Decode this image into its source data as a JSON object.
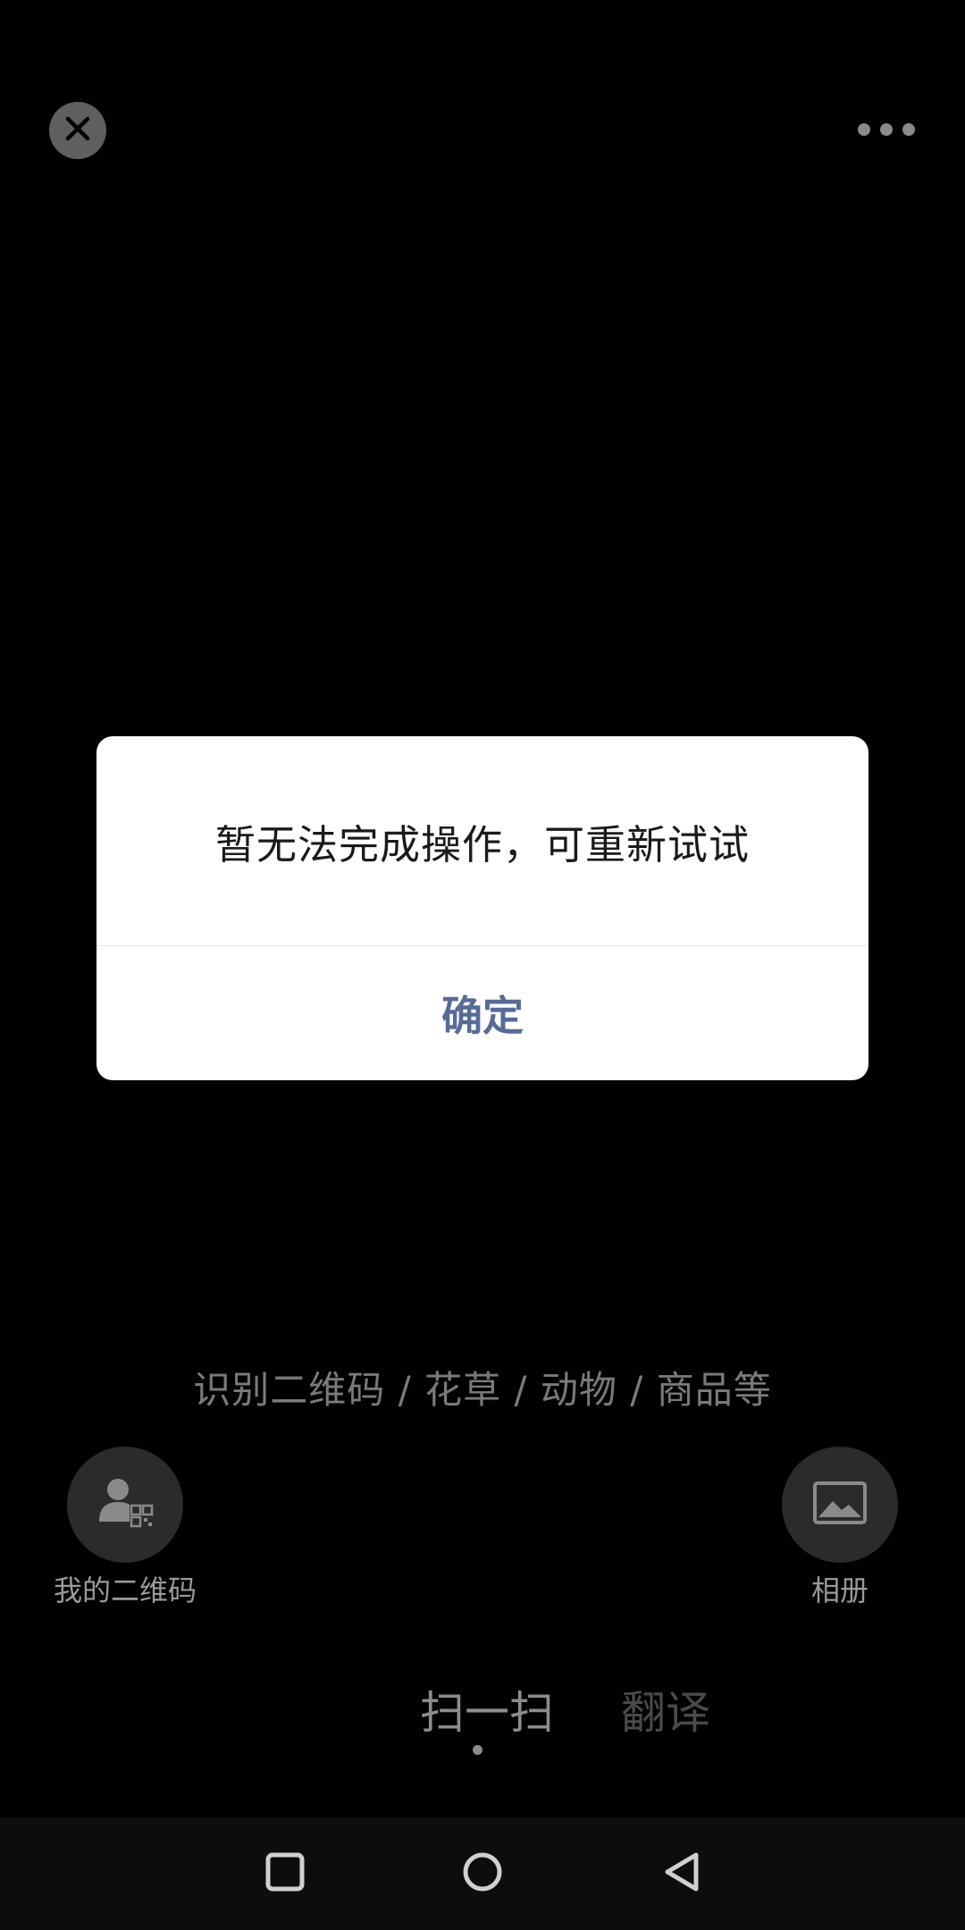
{
  "top_bar": {
    "close_icon": "close-icon",
    "more_icon": "more-horizontal-icon"
  },
  "dialog": {
    "message": "暂无法完成操作，可重新试试",
    "confirm_label": "确定"
  },
  "scanner": {
    "hint": "识别二维码 / 花草 / 动物 / 商品等"
  },
  "actions": {
    "my_qr_label": "我的二维码",
    "my_qr_icon": "user-qr-icon",
    "album_label": "相册",
    "album_icon": "image-icon"
  },
  "modes": {
    "tabs": [
      {
        "label": "扫一扫",
        "active": true
      },
      {
        "label": "翻译",
        "active": false
      }
    ]
  },
  "system_nav": {
    "recent_icon": "square-icon",
    "home_icon": "circle-icon",
    "back_icon": "triangle-back-icon"
  },
  "colors": {
    "background": "#000000",
    "dialog_bg": "#ffffff",
    "confirm_text": "#576b95",
    "hint_text": "#7a7a7a"
  }
}
